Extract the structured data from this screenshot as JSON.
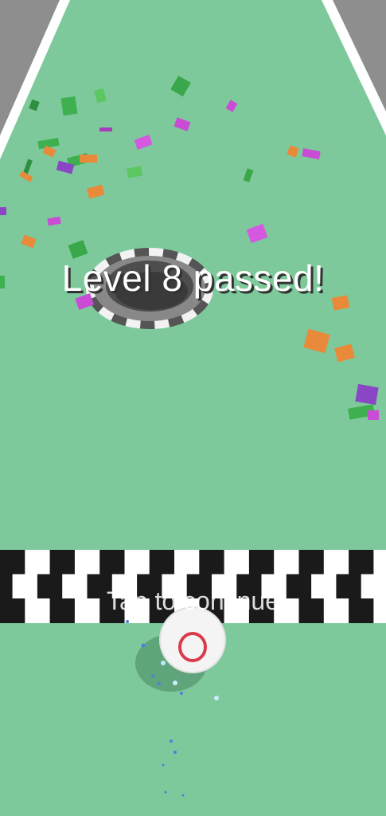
{
  "game": {
    "title_text": "Level 8 passed!",
    "hint_text": "Tap to continue",
    "level": 8
  },
  "colors": {
    "ground": "#7dc99b",
    "side_wall": "#8e8e8e",
    "rail": "#ffffff",
    "checker_dark": "#1a1a1a",
    "checker_light": "#ffffff",
    "ball": "#f4f4f4",
    "ball_ring": "#d93b4b",
    "confetti": [
      "#3fb04f",
      "#c94bd6",
      "#e88a3a"
    ]
  }
}
